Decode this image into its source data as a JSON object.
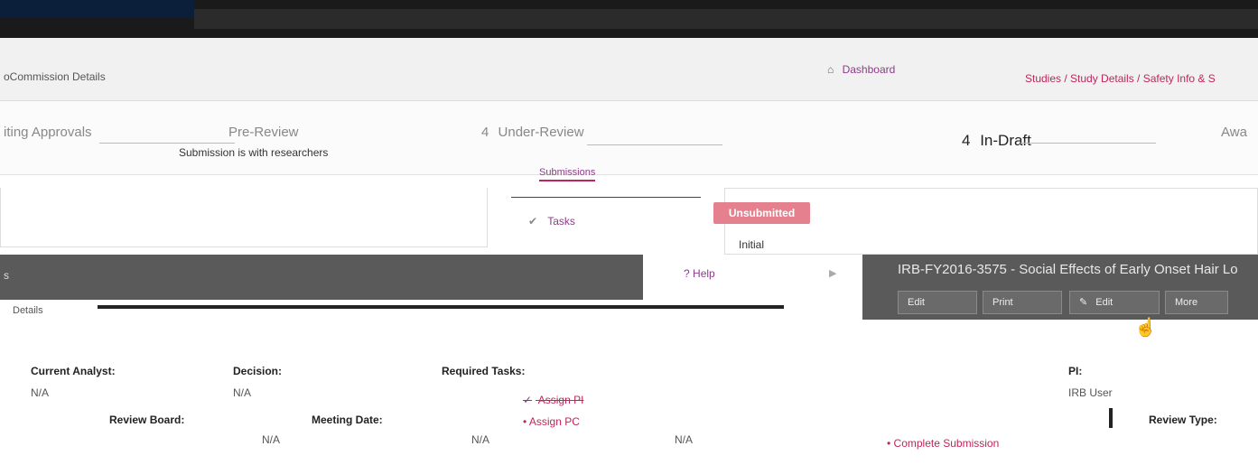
{
  "header": {
    "breadcrumb_left": "oCommission Details",
    "home_label": "Dashboard",
    "breadcrumb_right": "Studies / Study Details / Safety Info & S"
  },
  "workflow": {
    "steps": [
      {
        "num": "",
        "label": "iting Approvals"
      },
      {
        "num": "",
        "label": "Pre-Review"
      },
      {
        "num": "4",
        "label": "Under-Review"
      },
      {
        "num": "4",
        "label": "In-Draft"
      },
      {
        "num": "",
        "label": "Awa"
      }
    ],
    "note": "Submission is with researchers"
  },
  "nav": {
    "top_link": "Submissions",
    "tasks_label": "Tasks",
    "help_label": "Help"
  },
  "status": {
    "badge": "Unsubmitted",
    "initial": "Initial"
  },
  "study": {
    "left_label": "s",
    "sub_label": "Details",
    "title": "IRB-FY2016-3575 - Social Effects of Early Onset Hair Lo",
    "buttons": [
      "Edit",
      "Print",
      "Edit",
      "More"
    ]
  },
  "details": {
    "current_analyst_label": "Current Analyst:",
    "current_analyst_value": "N/A",
    "decision_label": "Decision:",
    "decision_value": "N/A",
    "required_tasks_label": "Required Tasks:",
    "tasks": [
      {
        "label": "Assign PI",
        "done": true
      },
      {
        "label": "Assign PC",
        "done": false
      },
      {
        "label": "Complete Submission",
        "done": false
      }
    ],
    "pi_label": "PI:",
    "pi_value": "IRB User",
    "review_board_label": "Review Board:",
    "review_board_value": "N/A",
    "meeting_date_label": "Meeting Date:",
    "meeting_date_value": "N/A",
    "third_value": "N/A",
    "review_type_label": "Review Type:"
  },
  "colors": {
    "accent": "#c0245c",
    "link": "#8e3b8a",
    "badge": "#e5818f",
    "dark_bar": "#5a5a5a"
  }
}
